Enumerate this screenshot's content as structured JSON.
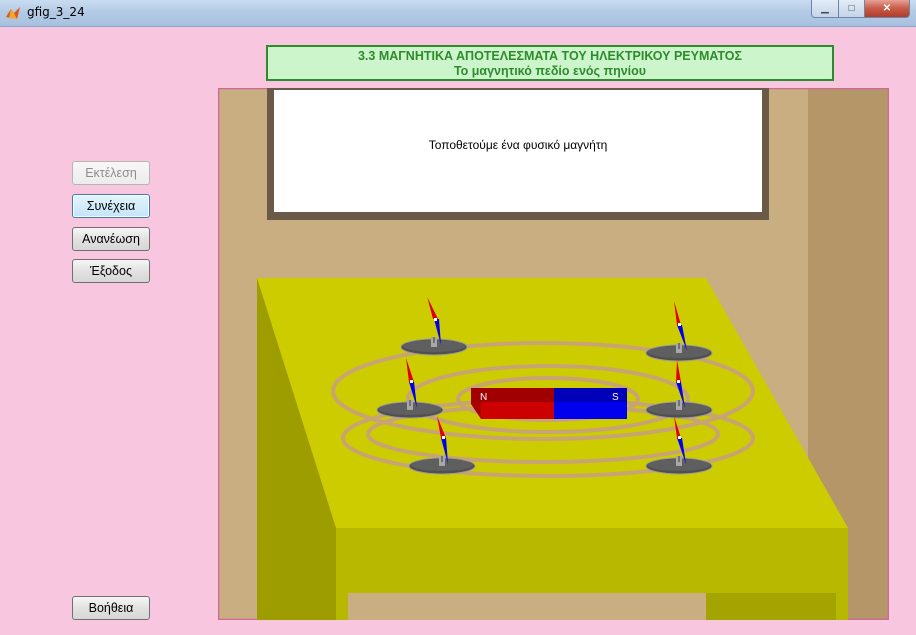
{
  "window": {
    "title": "gfig_3_24"
  },
  "header": {
    "line1": "3.3 ΜΑΓΝΗΤΙΚΑ ΑΠΟΤΕΛΕΣΜΑΤΑ ΤΟΥ ΗΛΕΚΤΡΙΚΟΥ ΡΕΥΜΑΤΟΣ",
    "line2": "Το μαγνητικό πεδίο ενός πηνίου"
  },
  "buttons": {
    "run": "Εκτέλεση",
    "continue": "Συνέχεια",
    "refresh": "Ανανέωση",
    "exit": "Έξοδος",
    "help": "Βοήθεια"
  },
  "board": {
    "text": "Τοποθετούμε ένα φυσικό μαγνήτη"
  },
  "magnet": {
    "north_label": "N",
    "south_label": "S"
  },
  "colors": {
    "background": "#f9c6e0",
    "header_fill": "#ccf5cc",
    "header_text": "#2e8b2e",
    "wall": "#c9ae82",
    "table_top": "#cccc00",
    "magnet_north": "#cc0000",
    "magnet_south": "#0000ee"
  }
}
